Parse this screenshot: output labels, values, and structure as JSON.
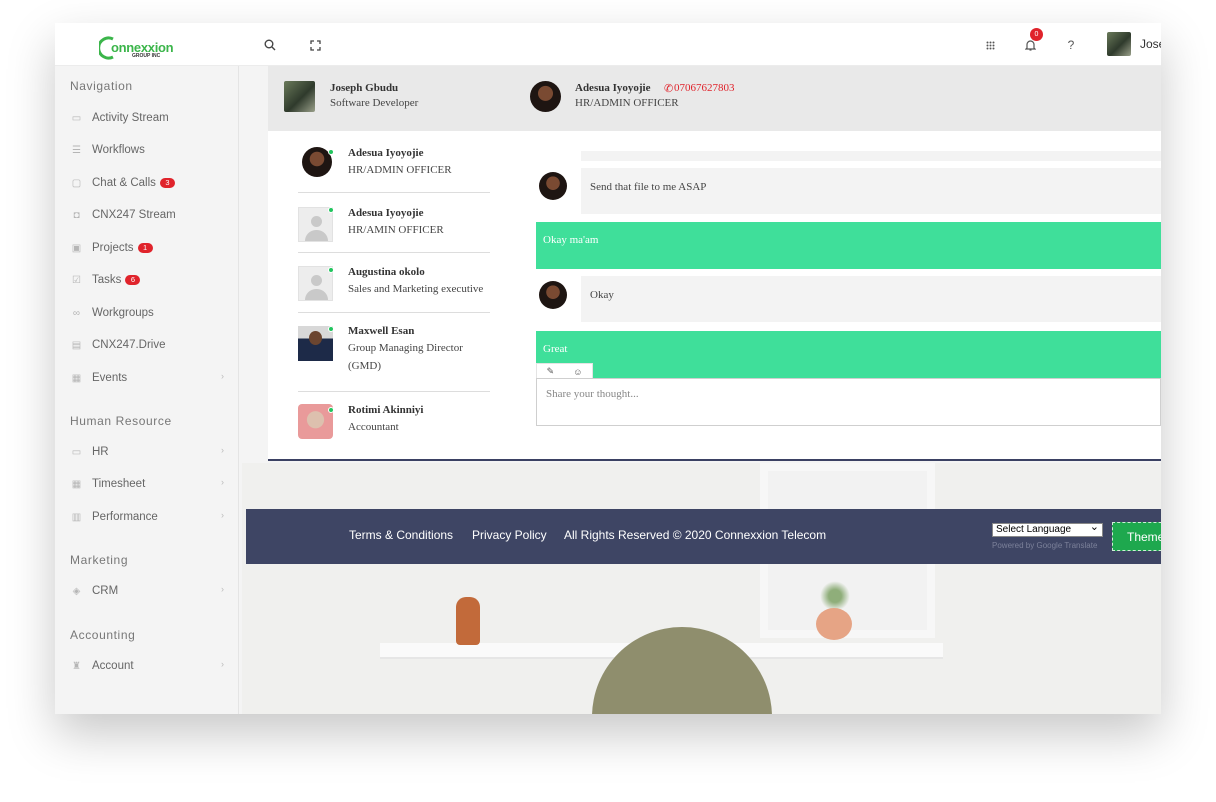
{
  "topbar": {
    "logo_text": "onnexxion",
    "logo_sub": "GROUP INC",
    "notification_count": "0",
    "help_label": "?",
    "user_name": "Jose"
  },
  "sidebar": {
    "sections": [
      {
        "title": "Navigation"
      },
      {
        "title": "Human Resource"
      },
      {
        "title": "Marketing"
      },
      {
        "title": "Accounting"
      }
    ],
    "items": [
      {
        "label": "Activity Stream",
        "icon": "activity-icon"
      },
      {
        "label": "Workflows",
        "icon": "menu-icon"
      },
      {
        "label": "Chat & Calls",
        "icon": "chat-icon",
        "badge": "3"
      },
      {
        "label": "CNX247 Stream",
        "icon": "camera-icon"
      },
      {
        "label": "Projects",
        "icon": "briefcase-icon",
        "badge": "1"
      },
      {
        "label": "Tasks",
        "icon": "checkbox-icon",
        "badge": "6"
      },
      {
        "label": "Workgroups",
        "icon": "infinity-icon"
      },
      {
        "label": "CNX247.Drive",
        "icon": "drive-icon"
      },
      {
        "label": "Events",
        "icon": "calendar-icon"
      },
      {
        "label": "HR",
        "icon": "id-card-icon"
      },
      {
        "label": "Timesheet",
        "icon": "calendar-icon"
      },
      {
        "label": "Performance",
        "icon": "bar-chart-icon"
      },
      {
        "label": "CRM",
        "icon": "cube-icon"
      },
      {
        "label": "Account",
        "icon": "money-bag-icon"
      }
    ]
  },
  "chat_header": {
    "me": {
      "name": "Joseph Gbudu",
      "role": "Software Developer"
    },
    "peer": {
      "name": "Adesua Iyoyojie",
      "role": "HR/ADMIN OFFICER",
      "phone": "07067627803"
    }
  },
  "contacts": [
    {
      "name": "Adesua Iyoyojie",
      "role": "HR/ADMIN OFFICER"
    },
    {
      "name": "Adesua Iyoyojie",
      "role": "HR/AMIN OFFICER"
    },
    {
      "name": "Augustina okolo",
      "role": "Sales and Marketing executive"
    },
    {
      "name": "Maxwell Esan",
      "role": "Group Managing Director (GMD)"
    },
    {
      "name": "Rotimi Akinniyi",
      "role": "Accountant"
    }
  ],
  "messages": [
    {
      "direction": "in",
      "text": "Send that file to me ASAP"
    },
    {
      "direction": "out",
      "text": "Okay ma'am"
    },
    {
      "direction": "in",
      "text": "Okay"
    },
    {
      "direction": "out",
      "text": "Great"
    }
  ],
  "composer": {
    "placeholder": "Share your thought..."
  },
  "footer": {
    "terms": "Terms & Conditions",
    "privacy": "Privacy Policy",
    "rights": "All Rights Reserved © 2020 Connexxion Telecom",
    "language_select": "Select Language",
    "powered_by": "Powered by Google Translate",
    "theme_button": "Theme"
  },
  "colors": {
    "accent_green": "#3fdf9a",
    "footer_bg": "#3e4564",
    "badge_red": "#e0232b",
    "online_dot": "#22c55e"
  }
}
